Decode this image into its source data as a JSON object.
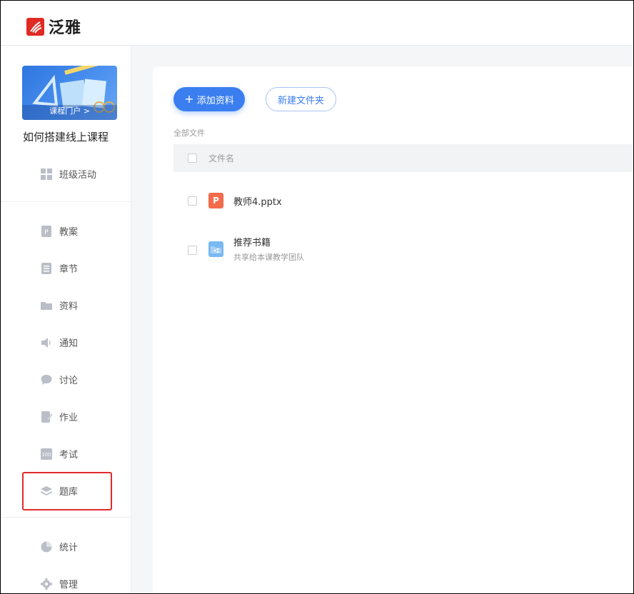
{
  "app": {
    "logo_text": "泛雅"
  },
  "sidebar": {
    "portal_label": "课程门户 >",
    "course_title": "如何搭建线上课程",
    "class_activity": "班级活动",
    "items": [
      {
        "label": "教案",
        "icon": "lesson-plan-icon"
      },
      {
        "label": "章节",
        "icon": "chapter-icon"
      },
      {
        "label": "资料",
        "icon": "folder-icon"
      },
      {
        "label": "通知",
        "icon": "speaker-icon"
      },
      {
        "label": "讨论",
        "icon": "chat-bubble-icon"
      },
      {
        "label": "作业",
        "icon": "homework-icon"
      },
      {
        "label": "考试",
        "icon": "exam-icon"
      },
      {
        "label": "题库",
        "icon": "layers-icon"
      }
    ],
    "bottom_items": [
      {
        "label": "统计",
        "icon": "pie-chart-icon"
      },
      {
        "label": "管理",
        "icon": "gear-icon"
      }
    ]
  },
  "toolbar": {
    "add_label": "添加资料",
    "new_folder_label": "新建文件夹"
  },
  "breadcrumb": "全部文件",
  "table": {
    "header_name": "文件名",
    "rows": [
      {
        "name": "教师4.pptx",
        "type": "ppt",
        "icon_letter": "P"
      },
      {
        "name": "推荐书籍",
        "type": "folder",
        "subtitle": "共享给本课教学团队"
      }
    ]
  },
  "colors": {
    "accent": "#3a7ef0",
    "brand": "#e12a23",
    "highlight": "#e02a2a"
  }
}
